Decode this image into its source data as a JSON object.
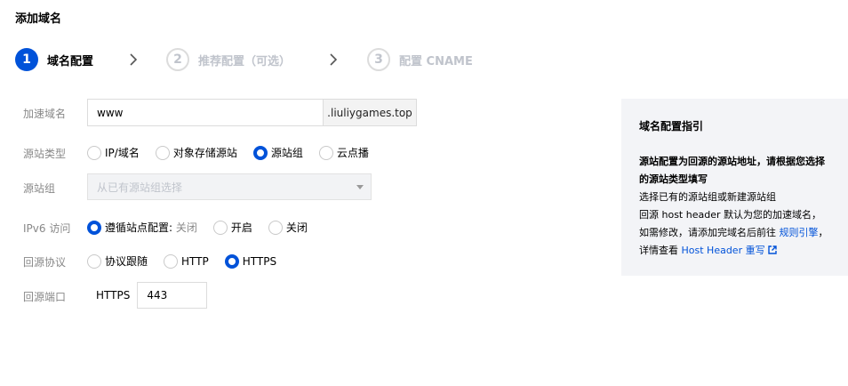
{
  "title": "添加域名",
  "steps": [
    {
      "number": "1",
      "label": "域名配置",
      "active": true
    },
    {
      "number": "2",
      "label": "推荐配置（可选）",
      "active": false
    },
    {
      "number": "3",
      "label": "配置 CNAME",
      "active": false
    }
  ],
  "form": {
    "domain": {
      "label": "加速域名",
      "value": "www",
      "suffix": ".liuliygames.top"
    },
    "origin_type": {
      "label": "源站类型",
      "options": [
        "IP/域名",
        "对象存储源站",
        "源站组",
        "云点播"
      ],
      "selected": "源站组"
    },
    "origin_group": {
      "label": "源站组",
      "placeholder": "从已有源站组选择"
    },
    "ipv6": {
      "label": "IPv6 访问",
      "options": [
        {
          "text": "遵循站点配置:",
          "sub": "关闭"
        },
        {
          "text": "开启",
          "sub": ""
        },
        {
          "text": "关闭",
          "sub": ""
        }
      ],
      "selected_index": 0
    },
    "origin_protocol": {
      "label": "回源协议",
      "options": [
        "协议跟随",
        "HTTP",
        "HTTPS"
      ],
      "selected": "HTTPS"
    },
    "origin_port": {
      "label": "回源端口",
      "protocol": "HTTPS",
      "value": "443"
    }
  },
  "guide": {
    "title": "域名配置指引",
    "bold_text": "源站配置为回源的源站地址，请根据您选择的源站类型填写",
    "line1": "选择已有的源站组或新建源站组",
    "line2": "回源 host header 默认为您的加速域名，如需修改，请添加完域名后前往",
    "link_rules": "规则引擎",
    "line3": "，详情查看",
    "link_host": "Host Header 重写"
  },
  "colors": {
    "accent": "#0052d9",
    "panel_bg": "#f3f4f7"
  }
}
